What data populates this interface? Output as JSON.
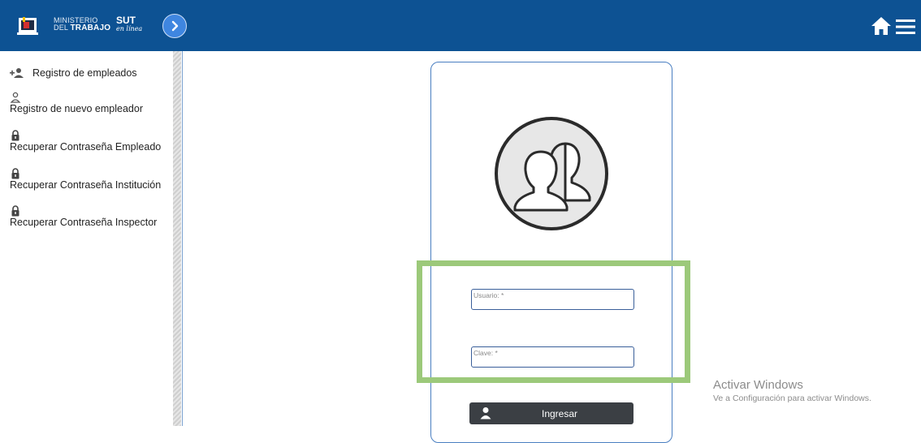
{
  "header": {
    "brand_ministerio_line1": "MINISTERIO",
    "brand_ministerio_line2_prefix": "DEL ",
    "brand_ministerio_line2_bold": "TRABAJO",
    "brand_sut": "SUT",
    "brand_sut_sub": "en línea",
    "colors": {
      "bar": "#0d5293",
      "toggle": "#3f86e0"
    }
  },
  "sidebar": {
    "items": [
      {
        "label": "Registro de empleados",
        "icon": "person-add-icon"
      },
      {
        "label": "Registro de nuevo empleador",
        "icon": "person-outline-icon"
      },
      {
        "label": "Recuperar Contraseña Empleado",
        "icon": "lock-icon"
      },
      {
        "label": "Recuperar Contraseña Institución",
        "icon": "lock-icon"
      },
      {
        "label": "Recuperar Contraseña Inspector",
        "icon": "lock-icon"
      }
    ]
  },
  "login": {
    "usuario_placeholder": "Usuario: *",
    "clave_placeholder": "Clave: *",
    "submit_label": "Ingresar",
    "colors": {
      "highlight": "#9cc97a",
      "button": "#3b3f44"
    }
  },
  "watermark": {
    "title": "Activar Windows",
    "subtitle": "Ve a Configuración para activar Windows."
  }
}
